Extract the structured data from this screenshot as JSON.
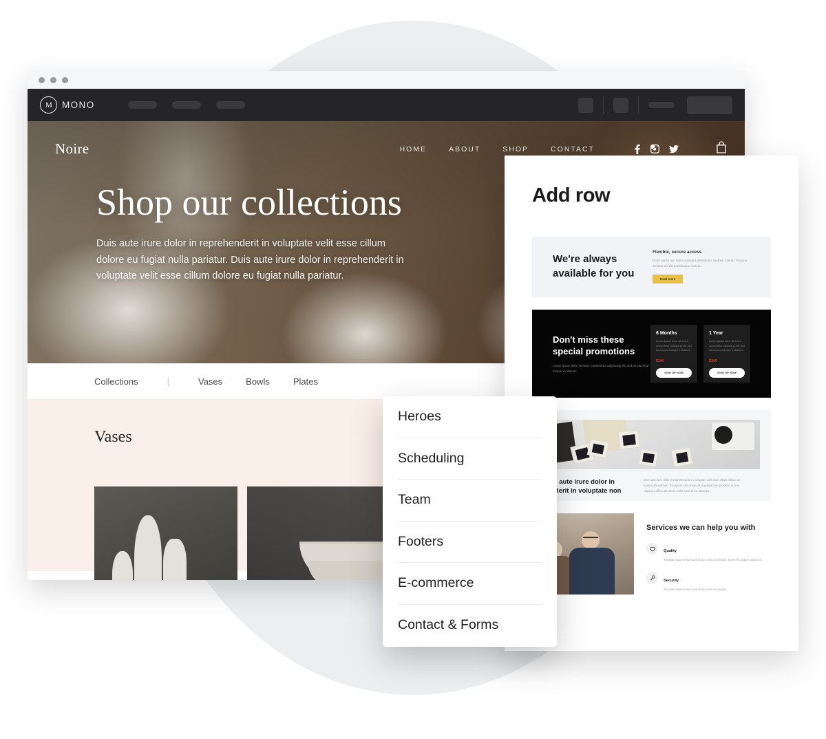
{
  "browser": {
    "app": {
      "logo_mark": "M",
      "logo_text": "MONO"
    }
  },
  "site": {
    "brand": "Noire",
    "nav": [
      {
        "label": "HOME"
      },
      {
        "label": "ABOUT"
      },
      {
        "label": "SHOP"
      },
      {
        "label": "CONTACT"
      }
    ],
    "social": [
      {
        "name": "facebook-icon"
      },
      {
        "name": "instagram-icon"
      },
      {
        "name": "twitter-icon"
      }
    ],
    "cart": {
      "name": "shopping-bag-icon"
    },
    "hero": {
      "title": "Shop our collections",
      "subtitle": "Duis aute irure dolor in reprehenderit in voluptate velit esse cillum dolore eu fugiat nulla pariatur. Duis aute irure dolor in reprehenderit in voluptate velit esse cillum dolore eu fugiat nulla pariatur."
    },
    "collections_bar": {
      "label": "Collections",
      "divider": "|",
      "links": [
        {
          "label": "Vases"
        },
        {
          "label": "Bowls"
        },
        {
          "label": "Plates"
        }
      ]
    },
    "vases_section": {
      "title": "Vases"
    }
  },
  "add_row": {
    "title": "Add row",
    "block_light": {
      "heading": "We're always available for you",
      "mini_heading": "Flexible, secure access",
      "mini_text": "Dolor purus non enim praesent elementum facilisis. Mauris rhoncus aenean vel elit scelerisque mauris.",
      "button": "Read more",
      "accent": "#e8c045"
    },
    "block_dark": {
      "heading": "Don't miss these special promotions",
      "text": "Lorem ipsum dolor sit amet, consectetur adipiscing elit, sed do eiusmod tempor incididunt.",
      "price_color": "#d63b22",
      "cards": [
        {
          "title": "6 Months",
          "text": "Lorem ipsum dolor sit amet, consectetur adipiscing elit, sed do eiusmod tempor incididunt.",
          "price": "$200",
          "button": "SIGN UP NOW"
        },
        {
          "title": "1 Year",
          "text": "Lorem ipsum dolor sit amet, consectetur adipiscing elit, sed do eiusmod tempor incididunt.",
          "price": "$200",
          "button": "SIGN UP NOW"
        }
      ]
    },
    "block_photo": {
      "heading": "Duis aute irure dolor in henderit in voluptate non",
      "text": "Duis aute irure dolor in reprehenderit in voluptate velit esse cillum dolore eu fugiat nulla pariatur. Excepteur sint occaecat cupidatat non proident, sunt in culpa qui officia deserunt mollit anim id est laborum."
    },
    "block_services": {
      "heading": "Services we can help you with",
      "items": [
        {
          "icon": "heart-icon",
          "name": "Quality",
          "text": "Tincidunt vitae semper quis lectus nulla at volutpat. Eget velit aliquet sagittis id."
        },
        {
          "icon": "key-icon",
          "name": "Security",
          "text": "Tincidunt vitae semper quis lectus nulla at volutpat."
        }
      ]
    }
  },
  "dropdown": {
    "items": [
      {
        "label": "Heroes"
      },
      {
        "label": "Scheduling"
      },
      {
        "label": "Team"
      },
      {
        "label": "Footers"
      },
      {
        "label": "E-commerce"
      },
      {
        "label": "Contact & Forms"
      }
    ]
  }
}
